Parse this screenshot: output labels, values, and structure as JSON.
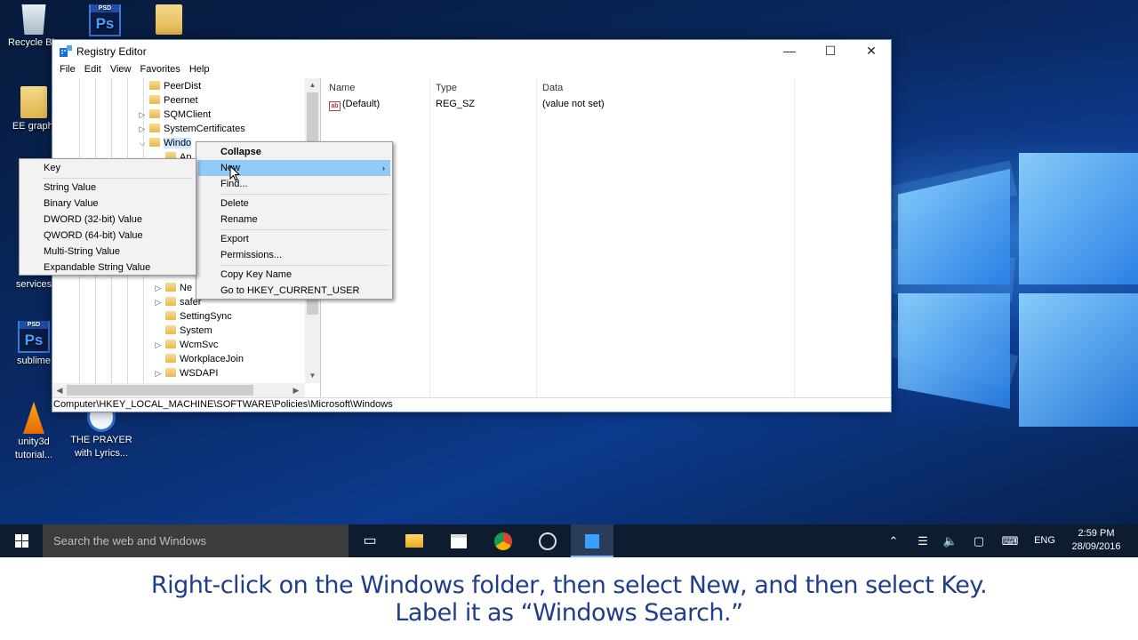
{
  "desktop": {
    "icons": [
      {
        "label": "Recycle Bin"
      },
      {
        "label": "",
        "badge": "PSD"
      },
      {
        "label": ""
      },
      {
        "label": "EE graphi"
      },
      {
        "label": "services"
      },
      {
        "label": "sublime",
        "badge": "PSD"
      },
      {
        "label": "unity3d tutorial..."
      },
      {
        "label": "THE PRAYER with Lyrics..."
      }
    ]
  },
  "window": {
    "title": "Registry Editor",
    "controls": {
      "minimize": "—",
      "maximize": "☐",
      "close": "✕"
    },
    "menu": [
      "File",
      "Edit",
      "View",
      "Favorites",
      "Help"
    ],
    "tree": {
      "items_top": [
        "PeerDist",
        "Peernet",
        "SQMClient",
        "SystemCertificates",
        "Windo"
      ],
      "items_partial": [
        "Ap"
      ],
      "items_bottom": [
        "Ne",
        "safer",
        "SettingSync",
        "System",
        "WcmSvc",
        "WorkplaceJoin",
        "WSDAPI"
      ]
    },
    "list": {
      "columns": [
        "Name",
        "Type",
        "Data"
      ],
      "rows": [
        {
          "name": "(Default)",
          "type": "REG_SZ",
          "data": "(value not set)"
        }
      ]
    },
    "status_path": "Computer\\HKEY_LOCAL_MACHINE\\SOFTWARE\\Policies\\Microsoft\\Windows"
  },
  "context_menu": {
    "items": [
      "Collapse",
      "New",
      "Find...",
      "Delete",
      "Rename",
      "Export",
      "Permissions...",
      "Copy Key Name",
      "Go to HKEY_CURRENT_USER"
    ],
    "highlighted": "New",
    "submenu_arrow": "›"
  },
  "new_submenu": {
    "items": [
      "Key",
      "String Value",
      "Binary Value",
      "DWORD (32-bit) Value",
      "QWORD (64-bit) Value",
      "Multi-String Value",
      "Expandable String Value"
    ]
  },
  "taskbar": {
    "search_placeholder": "Search the web and Windows",
    "tray": {
      "language": "ENG",
      "time": "2:59 PM",
      "date": "28/09/2016"
    }
  },
  "caption": {
    "line1": "Right-click on the Windows folder, then select New, and then select Key.",
    "line2": "Label it as “Windows Search.”"
  },
  "colors": {
    "menu_highlight": "#91c9f7",
    "caption_text": "#1f3e8a",
    "taskbar_bg": "#0e1c2f"
  }
}
